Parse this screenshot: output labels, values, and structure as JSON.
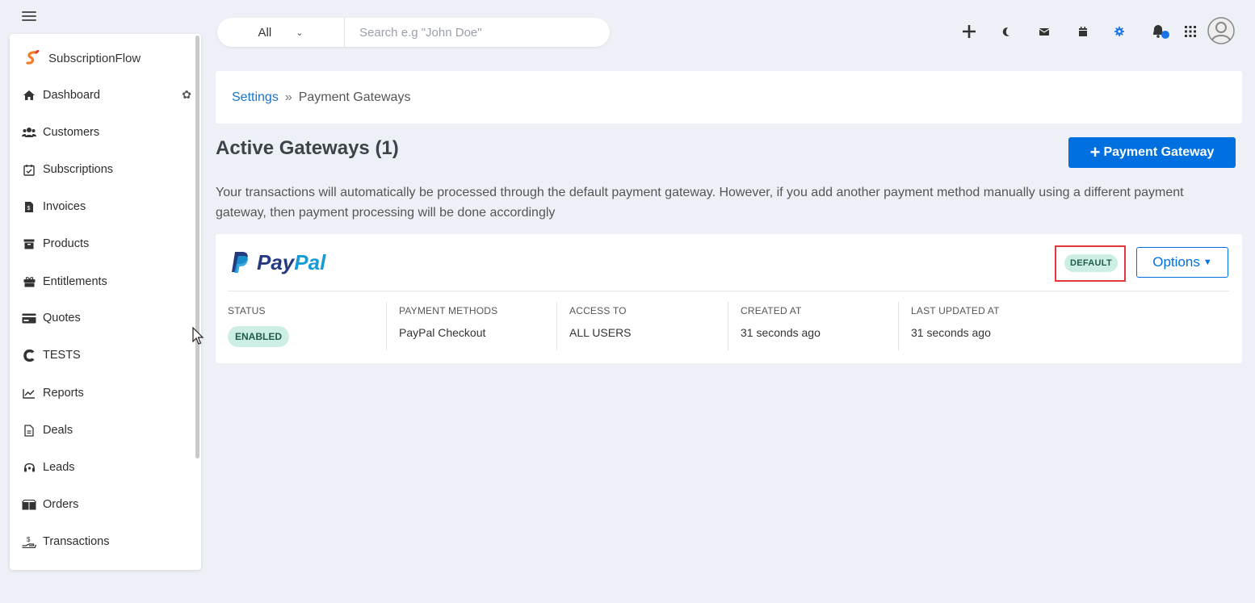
{
  "sidebar": {
    "brand": "SubscriptionFlow",
    "items": [
      {
        "label": "Dashboard",
        "icon": "home-icon"
      },
      {
        "label": "Customers",
        "icon": "users-icon"
      },
      {
        "label": "Subscriptions",
        "icon": "calendar-check-icon"
      },
      {
        "label": "Invoices",
        "icon": "invoice-icon"
      },
      {
        "label": "Products",
        "icon": "archive-icon"
      },
      {
        "label": "Entitlements",
        "icon": "gift-icon"
      },
      {
        "label": "Quotes",
        "icon": "card-icon"
      },
      {
        "label": "TESTS",
        "icon": "c-icon"
      },
      {
        "label": "Reports",
        "icon": "chart-icon"
      },
      {
        "label": "Deals",
        "icon": "document-icon"
      },
      {
        "label": "Leads",
        "icon": "headset-icon"
      },
      {
        "label": "Orders",
        "icon": "boxes-icon"
      },
      {
        "label": "Transactions",
        "icon": "money-hand-icon"
      }
    ]
  },
  "search": {
    "scope": "All",
    "placeholder": "Search e.g \"John Doe\""
  },
  "topbar_icons": [
    "plus-icon",
    "moon-icon",
    "envelope-icon",
    "calendar-icon",
    "gear-icon",
    "bell-icon",
    "grid-icon",
    "avatar"
  ],
  "breadcrumb": {
    "parent": "Settings",
    "separator": "»",
    "current": "Payment Gateways"
  },
  "page": {
    "title": "Active Gateways (1)",
    "add_button": "Payment Gateway",
    "description": "Your transactions will automatically be processed through the default payment gateway. However, if you add another payment method manually using a different payment gateway, then payment processing will be done accordingly"
  },
  "gateway": {
    "logo_text_a": "Pay",
    "logo_text_b": "Pal",
    "default_badge": "DEFAULT",
    "options_label": "Options",
    "columns": [
      {
        "label": "STATUS",
        "value": "ENABLED"
      },
      {
        "label": "PAYMENT METHODS",
        "value": "PayPal Checkout"
      },
      {
        "label": "ACCESS TO",
        "value": "ALL USERS"
      },
      {
        "label": "CREATED AT",
        "value": "31 seconds ago"
      },
      {
        "label": "LAST UPDATED AT",
        "value": "31 seconds ago"
      }
    ]
  },
  "colors": {
    "primary": "#0070e0",
    "badge_bg": "#cdeee4",
    "highlight": "#e0383b",
    "brand_orange": "#f47b20"
  }
}
